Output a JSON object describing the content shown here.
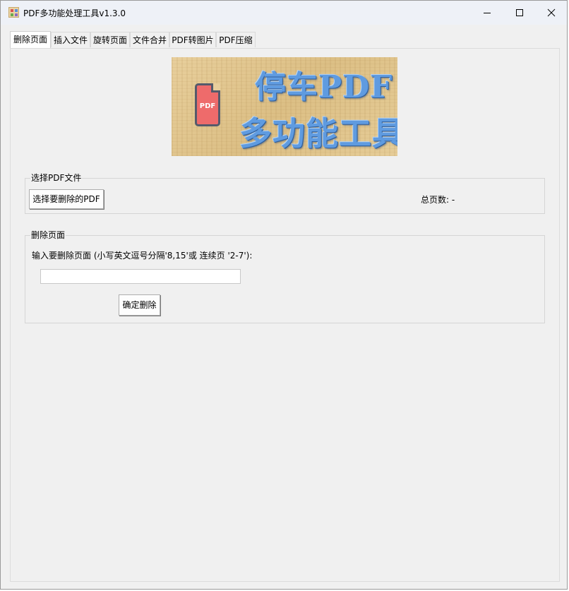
{
  "window": {
    "title": "PDF多功能处理工具v1.3.0"
  },
  "tabs": [
    {
      "label": "删除页面",
      "active": true
    },
    {
      "label": "插入文件"
    },
    {
      "label": "旋转页面"
    },
    {
      "label": "文件合并"
    },
    {
      "label": "PDF转图片"
    },
    {
      "label": "PDF压缩"
    }
  ],
  "banner": {
    "icon_label": "PDF",
    "line1": "停车PDF",
    "line2": "多功能工具"
  },
  "select_group": {
    "label": "选择PDF文件",
    "button_label": "选择要删除的PDF",
    "page_count_label": "总页数: -"
  },
  "delete_group": {
    "label": "删除页面",
    "instruction": "输入要删除页面 (小写英文逗号分隔'8,15'或 连续页 '2-7'):",
    "input_value": "",
    "confirm_label": "确定删除"
  },
  "colors": {
    "accent_text": "#5f9be0",
    "pdf_icon": "#ee6b6b"
  }
}
